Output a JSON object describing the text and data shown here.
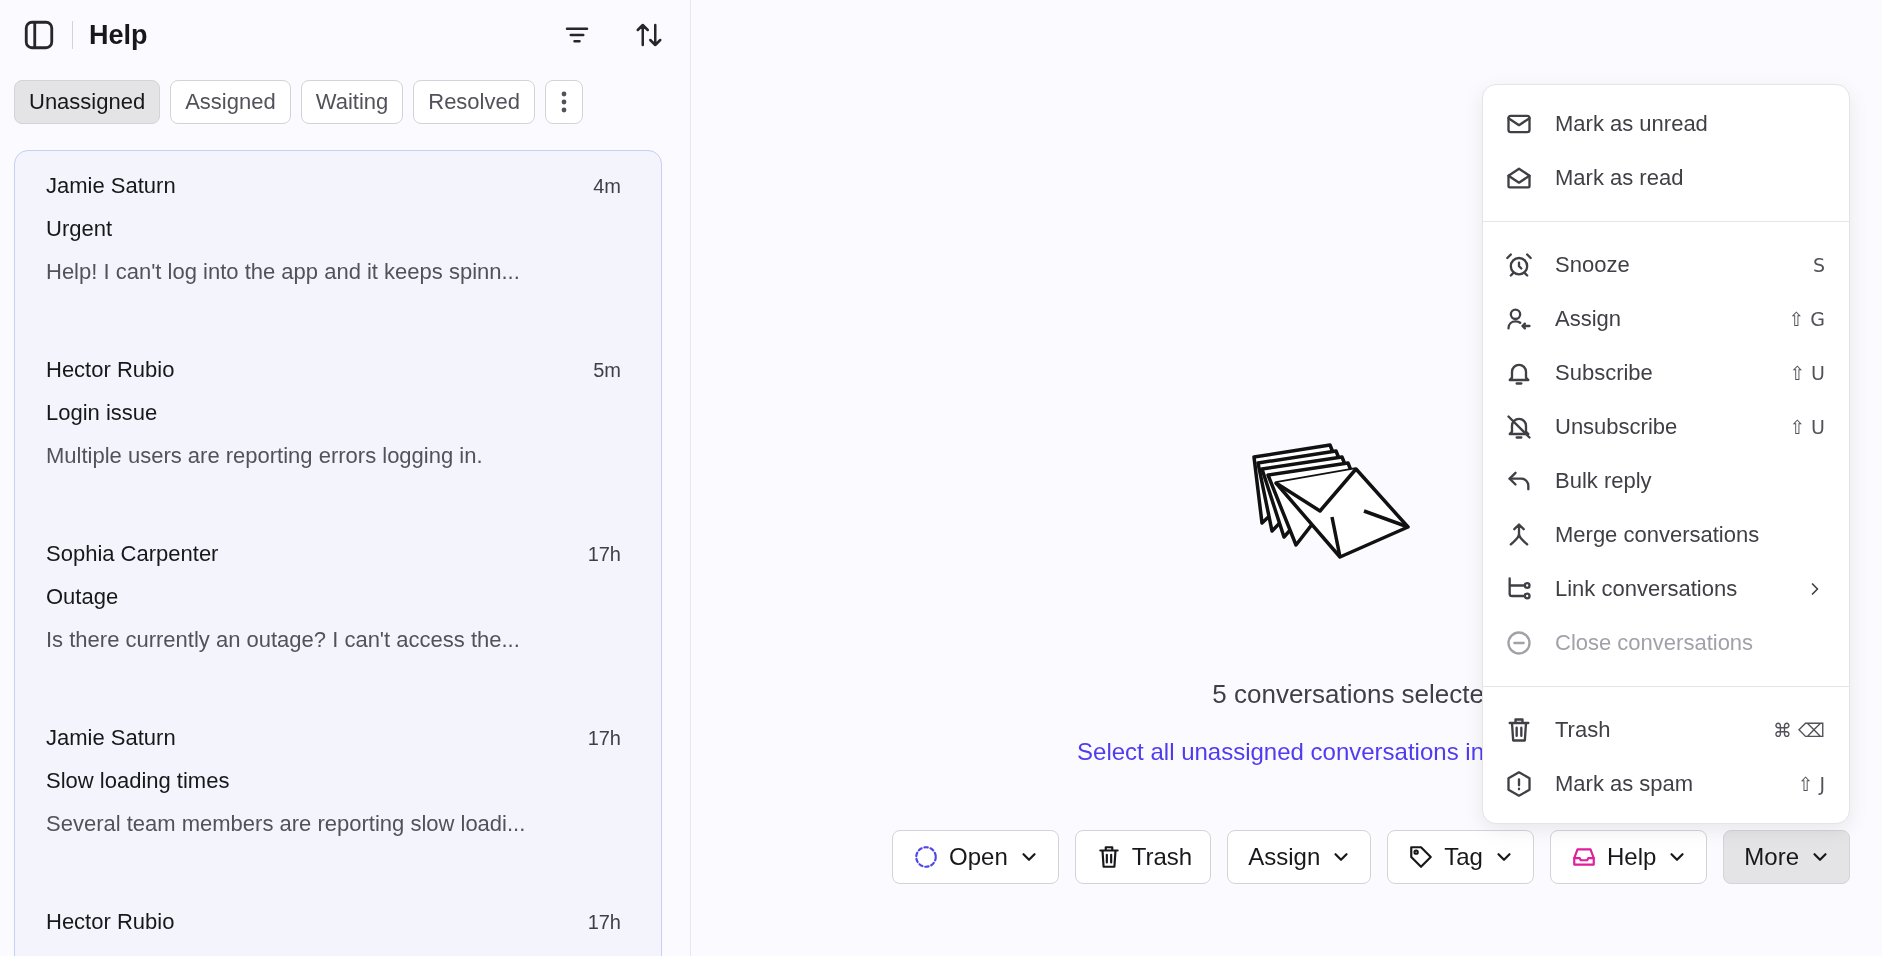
{
  "sidebar": {
    "title": "Help",
    "tabs": [
      {
        "label": "Unassigned",
        "selected": true
      },
      {
        "label": "Assigned",
        "selected": false
      },
      {
        "label": "Waiting",
        "selected": false
      },
      {
        "label": "Resolved",
        "selected": false
      }
    ],
    "conversations": [
      {
        "name": "Jamie Saturn",
        "time": "4m",
        "subject": "Urgent",
        "preview": "Help! I can't log into the app and it keeps spinn..."
      },
      {
        "name": "Hector Rubio",
        "time": "5m",
        "subject": "Login issue",
        "preview": "Multiple users are reporting errors logging in."
      },
      {
        "name": "Sophia Carpenter",
        "time": "17h",
        "subject": "Outage",
        "preview": "Is there currently an outage? I can't access the..."
      },
      {
        "name": "Jamie Saturn",
        "time": "17h",
        "subject": "Slow loading times",
        "preview": "Several team members are reporting slow loadi..."
      },
      {
        "name": "Hector Rubio",
        "time": "17h"
      }
    ]
  },
  "main": {
    "selection_text": "5 conversations selecte",
    "select_all_link": "Select all unassigned conversations in",
    "actions": [
      {
        "label": "Open",
        "kind": "status",
        "dropdown": true,
        "selected": false
      },
      {
        "label": "Trash",
        "kind": "trash",
        "dropdown": false,
        "selected": false
      },
      {
        "label": "Assign",
        "kind": "none",
        "dropdown": true,
        "selected": false
      },
      {
        "label": "Tag",
        "kind": "tag",
        "dropdown": true,
        "selected": false
      },
      {
        "label": "Help",
        "kind": "inbox",
        "dropdown": true,
        "selected": false
      },
      {
        "label": "More",
        "kind": "none",
        "dropdown": true,
        "selected": true
      }
    ]
  },
  "menu": {
    "sections": [
      [
        {
          "label": "Mark as unread",
          "kind": "mail",
          "disabled": false,
          "submenu": false
        },
        {
          "label": "Mark as read",
          "kind": "mail-open",
          "disabled": false,
          "submenu": false
        }
      ],
      [
        {
          "label": "Snooze",
          "kind": "alarm",
          "shortcut": "S",
          "disabled": false,
          "submenu": false
        },
        {
          "label": "Assign",
          "kind": "assign",
          "shortcut": "⇧ G",
          "disabled": false,
          "submenu": false
        },
        {
          "label": "Subscribe",
          "kind": "bell",
          "shortcut": "⇧ U",
          "disabled": false,
          "submenu": false
        },
        {
          "label": "Unsubscribe",
          "kind": "bell-off",
          "shortcut": "⇧ U",
          "disabled": false,
          "submenu": false
        },
        {
          "label": "Bulk reply",
          "kind": "reply",
          "disabled": false,
          "submenu": false
        },
        {
          "label": "Merge conversations",
          "kind": "merge",
          "disabled": false,
          "submenu": false
        },
        {
          "label": "Link conversations",
          "kind": "link",
          "disabled": false,
          "submenu": true
        },
        {
          "label": "Close conversations",
          "kind": "minus-circle",
          "disabled": true,
          "submenu": false
        }
      ],
      [
        {
          "label": "Trash",
          "kind": "trash",
          "shortcut": "⌘ ⌫",
          "disabled": false,
          "submenu": false
        },
        {
          "label": "Mark as spam",
          "kind": "spam",
          "shortcut": "⇧ J",
          "disabled": false,
          "submenu": false
        }
      ]
    ]
  }
}
